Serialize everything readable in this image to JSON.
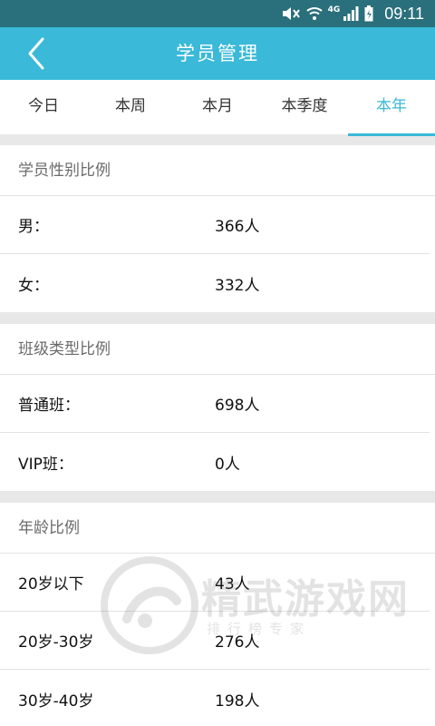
{
  "status_bar": {
    "time": "09:11",
    "network": "4G",
    "icons": [
      "mute-icon",
      "wifi-icon",
      "signal-icon",
      "battery-icon"
    ]
  },
  "header": {
    "title": "学员管理",
    "back_icon": "chevron-left-icon"
  },
  "tabs": [
    {
      "label": "今日"
    },
    {
      "label": "本周"
    },
    {
      "label": "本月"
    },
    {
      "label": "本季度"
    },
    {
      "label": "本年"
    }
  ],
  "active_tab": "本年",
  "sections": [
    {
      "title": "学员性别比例",
      "rows": [
        {
          "label": "男：",
          "value": "366人"
        },
        {
          "label": "女：",
          "value": "332人"
        }
      ]
    },
    {
      "title": "班级类型比例",
      "rows": [
        {
          "label": "普通班：",
          "value": "698人"
        },
        {
          "label": "VIP班：",
          "value": "0人"
        }
      ]
    },
    {
      "title": "年龄比例",
      "rows": [
        {
          "label": "20岁以下",
          "value": "43人"
        },
        {
          "label": "20岁-30岁",
          "value": "276人"
        },
        {
          "label": "30岁-40岁",
          "value": "198人"
        }
      ]
    }
  ],
  "watermark": {
    "text": "精武游戏网",
    "subtext": "排行榜专家"
  },
  "colors": {
    "status_bar": "#2a6f7c",
    "accent": "#3ab9d8",
    "background": "#e8e8e8"
  }
}
